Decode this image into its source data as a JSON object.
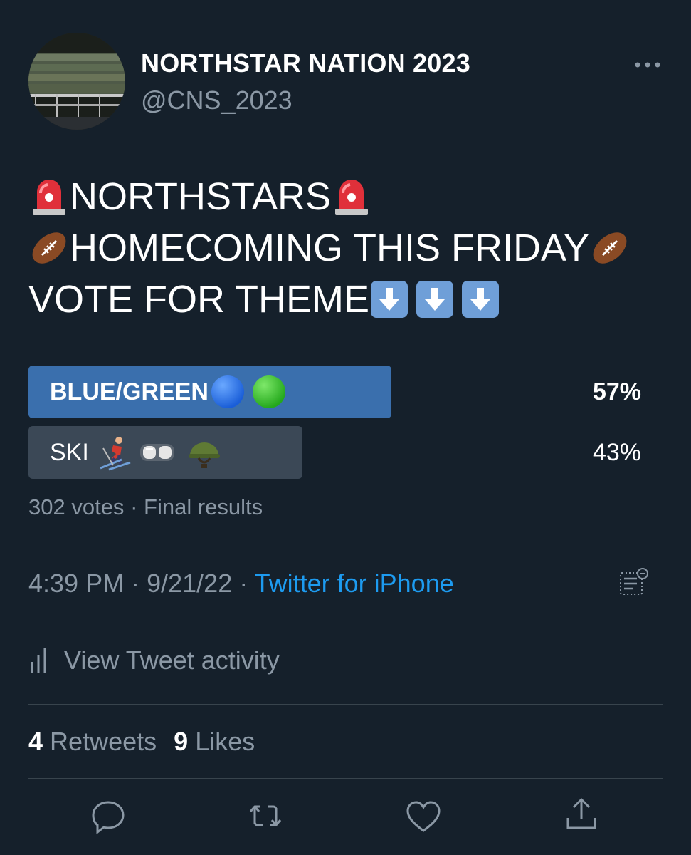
{
  "account": {
    "display_name": "NORTHSTAR NATION 2023",
    "handle": "@CNS_2023"
  },
  "tweet": {
    "lines": [
      {
        "text": "NORTHSTARS",
        "prefix_icon": "rotating-light-icon",
        "suffix_icons": [
          "rotating-light-icon"
        ]
      },
      {
        "text": "HOMECOMING THIS FRIDAY",
        "prefix_icon": "football-icon",
        "suffix_icons": [
          "football-icon"
        ]
      },
      {
        "text": "VOTE FOR THEME",
        "suffix_icons": [
          "down-arrow-icon",
          "down-arrow-icon",
          "down-arrow-icon"
        ]
      }
    ]
  },
  "poll": {
    "options": [
      {
        "label": "BLUE/GREEN",
        "percent": "57%",
        "value": 57,
        "icons": [
          "blue-circle-icon",
          "green-circle-icon"
        ],
        "winner": true
      },
      {
        "label": "SKI",
        "percent": "43%",
        "value": 43,
        "icons": [
          "skier-icon",
          "goggles-icon",
          "military-helmet-icon"
        ],
        "winner": false
      }
    ],
    "votes": "302 votes",
    "separator": "·",
    "status": "Final results"
  },
  "meta": {
    "time": "4:39 PM",
    "date": "9/21/22",
    "separator": "·",
    "source": "Twitter for iPhone"
  },
  "activity": {
    "label": "View Tweet activity"
  },
  "stats": {
    "retweets_count": "4",
    "retweets_label": "Retweets",
    "likes_count": "9",
    "likes_label": "Likes"
  },
  "colors": {
    "background": "#15202b",
    "winner_bar": "#3a6fad",
    "loser_bar": "#3b4856",
    "link": "#1d9bf0",
    "secondary_text": "#8b98a5",
    "divider": "#38444d"
  }
}
